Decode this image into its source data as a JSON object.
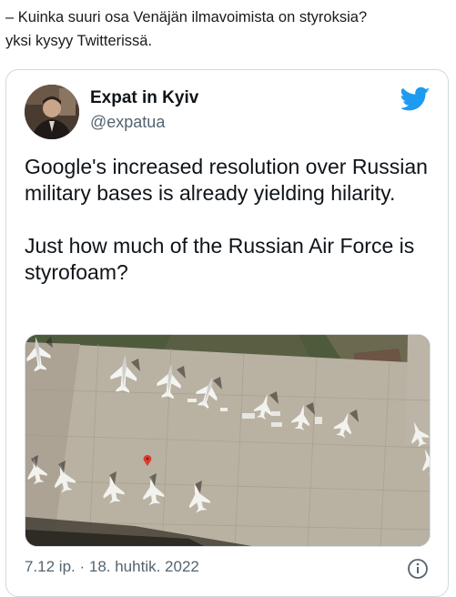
{
  "caption": {
    "line1": "– Kuinka suuri osa Venäjän ilmavoimista on styroksia?",
    "line2": "yksi kysyy Twitterissä."
  },
  "tweet": {
    "author_name": "Expat in Kyiv",
    "author_handle": "@expatua",
    "text_para1": "Google's increased resolution over Russian military bases is already yielding hilarity.",
    "text_para2": "Just how much of the Russian Air Force is styrofoam?",
    "timestamp": "7.12 ip. · 18. huhtik. 2022",
    "icons": {
      "brand": "twitter-bird-icon",
      "info": "info-icon",
      "map_pin": "map-pin-icon"
    },
    "colors": {
      "twitter_blue": "#1d9bf0",
      "secondary_text": "#536471",
      "border": "#cfd9de",
      "pin_red": "#e03a2f"
    }
  }
}
